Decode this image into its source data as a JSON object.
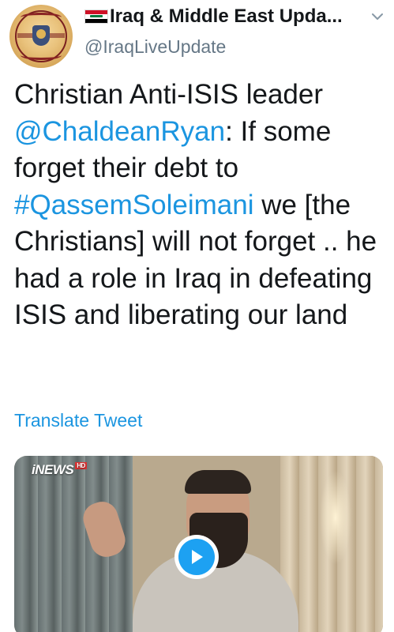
{
  "author": {
    "display_name": "Iraq & Middle East Upda...",
    "handle": "@IraqLiveUpdate",
    "flag_icon": "iraq-flag-icon",
    "avatar_icon": "ministry-seal-avatar"
  },
  "tweet": {
    "text_before_mention": "Christian Anti-ISIS leader ",
    "mention": "@ChaldeanRyan",
    "text_after_mention": ": If some forget their debt to ",
    "hashtag": "#QassemSoleimani",
    "text_after_hashtag": " we [the Christians] will not forget .. he had a role in Iraq in defeating ISIS and liberating our land",
    "translate_label": "Translate Tweet"
  },
  "media": {
    "channel_logo": "iNEWS",
    "channel_logo_badge": "HD",
    "play_icon": "play-icon"
  },
  "colors": {
    "link": "#1b95e0",
    "text": "#14171a",
    "secondary": "#657786",
    "play_button": "#1da1f2"
  }
}
